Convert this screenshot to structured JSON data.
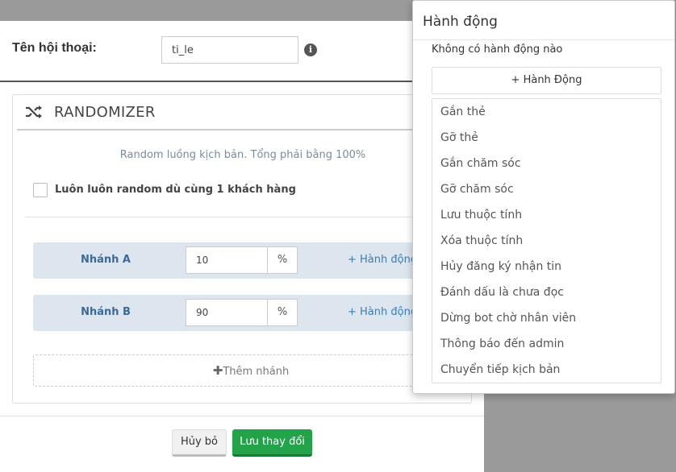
{
  "conversation": {
    "label": "Tên hội thoại:",
    "value": "ti_le",
    "info_glyph": "i"
  },
  "panel": {
    "title": "RANDOMIZER",
    "icon": "shuffle-icon",
    "description": "Random luồng kịch bản. Tổng phải bằng 100%",
    "always_random_label": "Luôn luôn random dù cùng 1 khách hàng"
  },
  "branches": [
    {
      "name": "Nhánh A",
      "value": "10",
      "unit": "%",
      "action_label": "+ Hành động"
    },
    {
      "name": "Nhánh B",
      "value": "90",
      "unit": "%",
      "action_label": "+ Hành động"
    }
  ],
  "add_branch_label": "Thêm nhánh",
  "footer": {
    "cancel_label": "Hủy bỏ",
    "save_label": "Lưu thay đổi"
  },
  "popover": {
    "title": "Hành động",
    "empty_text": "Không có hành động nào",
    "add_label": "+ Hành Động",
    "items": [
      "Gắn thẻ",
      "Gỡ thẻ",
      "Gắn chăm sóc",
      "Gỡ chăm sóc",
      "Lưu thuộc tính",
      "Xóa thuộc tính",
      "Hủy đăng ký nhận tin",
      "Đánh dấu là chưa đọc",
      "Dừng bot chờ nhân viên",
      "Thông báo đến admin",
      "Chuyển tiếp kịch bản"
    ]
  },
  "colors": {
    "save_button": "#22a34a",
    "branch_bg": "#dde6ee",
    "link": "#3a7cb8"
  }
}
